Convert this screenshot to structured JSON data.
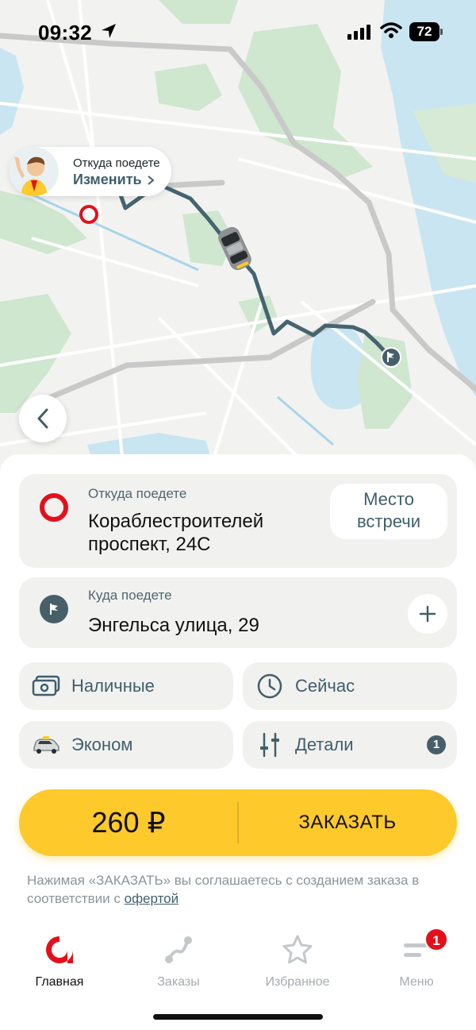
{
  "status_bar": {
    "time": "09:32",
    "battery": "72"
  },
  "map": {
    "pickup_bubble": {
      "caption": "Откуда поедете",
      "change_label": "Изменить"
    }
  },
  "route": {
    "from": {
      "caption": "Откуда поедете",
      "address": "Кораблестроителей проспект, 24С"
    },
    "meeting_point_label": "Место встречи",
    "to": {
      "caption": "Куда поедете",
      "address": "Энгельса улица, 29"
    }
  },
  "options": {
    "payment": {
      "label": "Наличные",
      "icon": "cash-icon"
    },
    "time": {
      "label": "Сейчас",
      "icon": "clock-icon"
    },
    "tariff": {
      "label": "Эконом",
      "icon": "taxi-car-icon"
    },
    "details": {
      "label": "Детали",
      "icon": "sliders-icon",
      "badge": "1"
    }
  },
  "order": {
    "price": "260 ₽",
    "label": "ЗАКАЗАТЬ"
  },
  "terms": {
    "text": "Нажимая «ЗАКАЗАТЬ» вы соглашаетесь с созданием заказа в соответствии с",
    "link": "офертой"
  },
  "tabs": [
    {
      "label": "Главная",
      "active": true
    },
    {
      "label": "Заказы",
      "active": false
    },
    {
      "label": "Избранное",
      "active": false
    },
    {
      "label": "Меню",
      "active": false,
      "badge": "1"
    }
  ],
  "colors": {
    "brand_yellow": "#fdc92b",
    "brand_red": "#e3101c",
    "accent_slate": "#3f5f6c"
  }
}
